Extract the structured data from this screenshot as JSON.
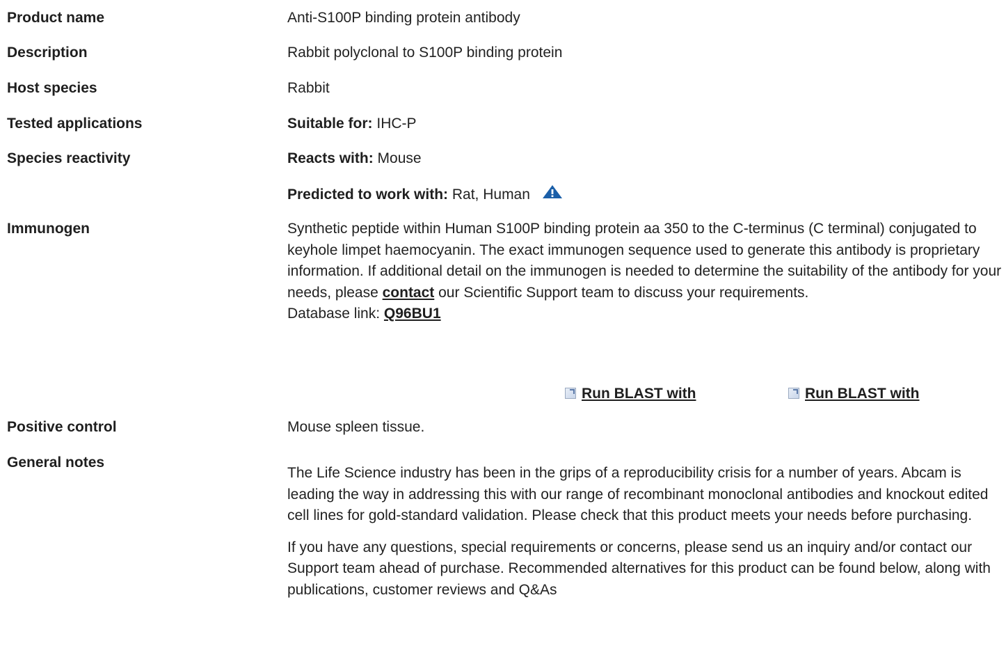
{
  "rows": {
    "product_name": {
      "label": "Product name",
      "value": "Anti-S100P binding protein antibody"
    },
    "description": {
      "label": "Description",
      "value": "Rabbit polyclonal to S100P binding protein"
    },
    "host_species": {
      "label": "Host species",
      "value": "Rabbit"
    },
    "tested_applications": {
      "label": "Tested applications",
      "prefix": "Suitable for:",
      "value": "IHC-P"
    },
    "species_reactivity": {
      "label": "Species reactivity",
      "reacts_prefix": "Reacts with:",
      "reacts_value": "Mouse",
      "predicted_prefix": "Predicted to work with:",
      "predicted_value": "Rat, Human",
      "warning_icon": "warning-triangle-icon"
    },
    "immunogen": {
      "label": "Immunogen",
      "text_before_link": "Synthetic peptide within Human S100P binding protein aa 350 to the C-terminus (C terminal) conjugated to keyhole limpet haemocyanin. The exact immunogen sequence used to generate this antibody is proprietary information. If additional detail on the immunogen is needed to determine the suitability of the antibody for your needs, please ",
      "contact_link": "contact",
      "text_after_link": " our Scientific Support team to discuss your requirements.",
      "database_prefix": "Database link: ",
      "database_link": "Q96BU1",
      "blast_1": "Run BLAST with",
      "blast_2": "Run BLAST with"
    },
    "positive_control": {
      "label": "Positive control",
      "value": "Mouse spleen tissue."
    },
    "general_notes": {
      "label": "General notes",
      "paragraph_1": "The Life Science industry has been in the grips of a reproducibility crisis for a number of years. Abcam is leading the way in addressing this with our range of recombinant monoclonal antibodies and knockout edited cell lines for gold-standard validation. Please check that this product meets your needs before purchasing.",
      "paragraph_2": "If you have any questions, special requirements or concerns, please send us an inquiry and/or contact our Support team ahead of purchase. Recommended alternatives for this product can be found below, along with publications, customer reviews and Q&As"
    }
  },
  "colors": {
    "warning_icon": "#1b5fa8",
    "text": "#222222"
  }
}
